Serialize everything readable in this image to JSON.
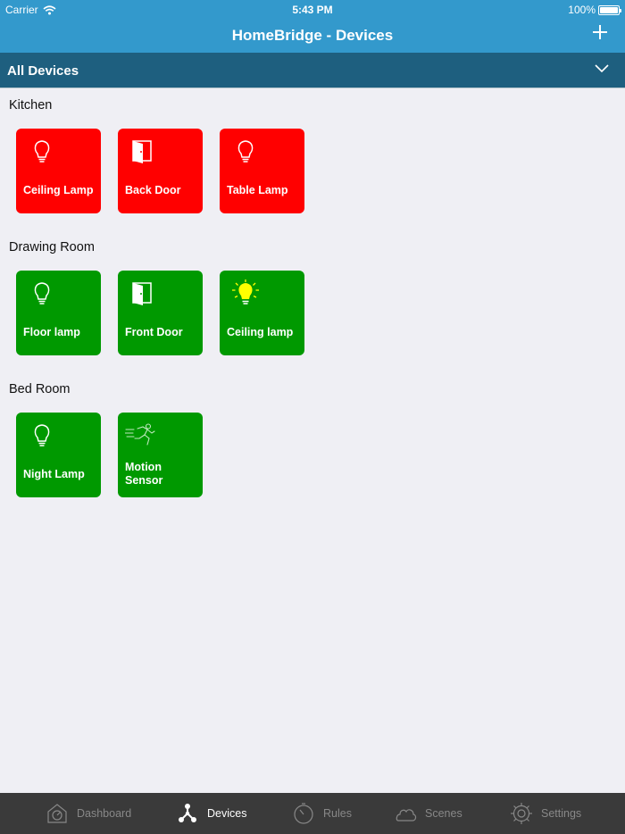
{
  "status_bar": {
    "carrier": "Carrier",
    "time": "5:43 PM",
    "battery": "100%"
  },
  "header": {
    "title": "HomeBridge - Devices",
    "add_icon": "plus-icon"
  },
  "filter": {
    "label": "All Devices",
    "icon": "chevron-down-icon"
  },
  "rooms": [
    {
      "name": "Kitchen",
      "devices": [
        {
          "label": "Ceiling Lamp",
          "icon": "bulb-icon",
          "state": "off"
        },
        {
          "label": "Back Door",
          "icon": "door-icon",
          "state": "off"
        },
        {
          "label": "Table Lamp",
          "icon": "bulb-icon",
          "state": "off"
        }
      ]
    },
    {
      "name": "Drawing Room",
      "devices": [
        {
          "label": "Floor lamp",
          "icon": "bulb-icon",
          "state": "on"
        },
        {
          "label": "Front Door",
          "icon": "door-icon",
          "state": "on"
        },
        {
          "label": "Ceiling lamp",
          "icon": "bulb-lit-icon",
          "state": "on"
        }
      ]
    },
    {
      "name": "Bed Room",
      "devices": [
        {
          "label": "Night Lamp",
          "icon": "bulb-icon",
          "state": "on"
        },
        {
          "label": "Motion Sensor",
          "icon": "running-person-icon",
          "state": "on"
        }
      ]
    }
  ],
  "colors": {
    "header": "#3399cc",
    "filter_bar": "#1e5f7f",
    "tile_off": "#ff0000",
    "tile_on": "#009900",
    "bulb_lit": "#ffff00",
    "tab_bar": "#3a3a3a"
  },
  "tabs": [
    {
      "label": "Dashboard",
      "icon": "dashboard-icon",
      "active": false
    },
    {
      "label": "Devices",
      "icon": "network-icon",
      "active": true
    },
    {
      "label": "Rules",
      "icon": "timer-icon",
      "active": false
    },
    {
      "label": "Scenes",
      "icon": "cloud-icon",
      "active": false
    },
    {
      "label": "Settings",
      "icon": "gear-icon",
      "active": false
    }
  ]
}
